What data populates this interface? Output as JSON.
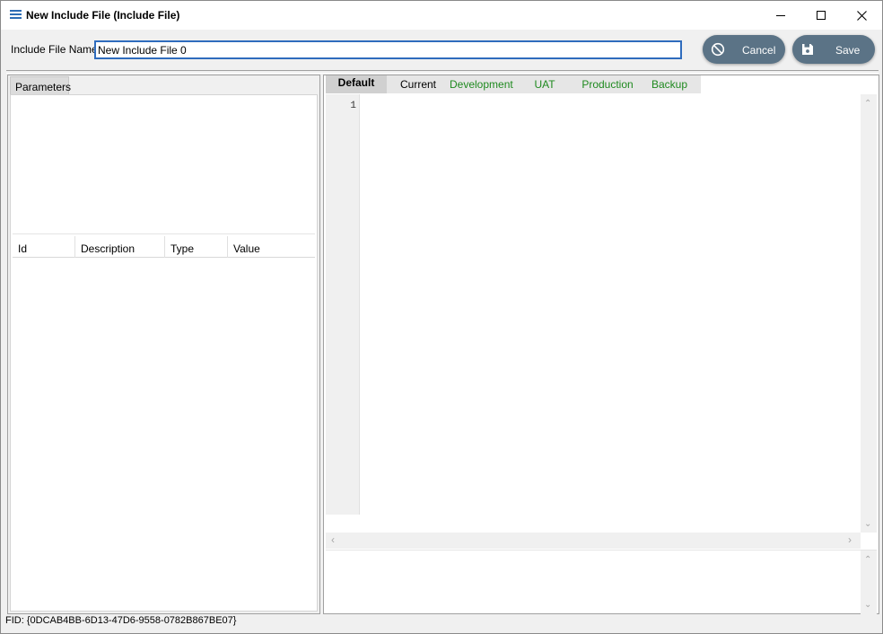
{
  "window": {
    "title": "New Include File (Include File)",
    "icon": "menu-lines-icon",
    "controls": [
      "minimize-icon",
      "maximize-icon",
      "close-icon"
    ],
    "accent": "#2f6cbd"
  },
  "form": {
    "name_label": "Include File Name",
    "name_value": "New Include File 0"
  },
  "actions": {
    "cancel_label": "Cancel",
    "save_label": "Save",
    "button_color": "#5b7386"
  },
  "left_panel": {
    "tab_label": "Parameters",
    "columns": [
      "Id",
      "Description",
      "Type",
      "Value"
    ],
    "rows": []
  },
  "right_panel": {
    "tabs": [
      {
        "label": "Default",
        "active": true
      },
      {
        "label": "Current"
      },
      {
        "label": "Development",
        "color": "#1f8a1f"
      },
      {
        "label": "UAT",
        "color": "#1f8a1f"
      },
      {
        "label": "Production",
        "color": "#1f8a1f"
      },
      {
        "label": "Backup",
        "color": "#1f8a1f"
      }
    ],
    "editor": {
      "line_numbers": [
        "1"
      ],
      "content": ""
    }
  },
  "status": {
    "fid": "FID: {0DCAB4BB-6D13-47D6-9558-0782B867BE07}"
  }
}
